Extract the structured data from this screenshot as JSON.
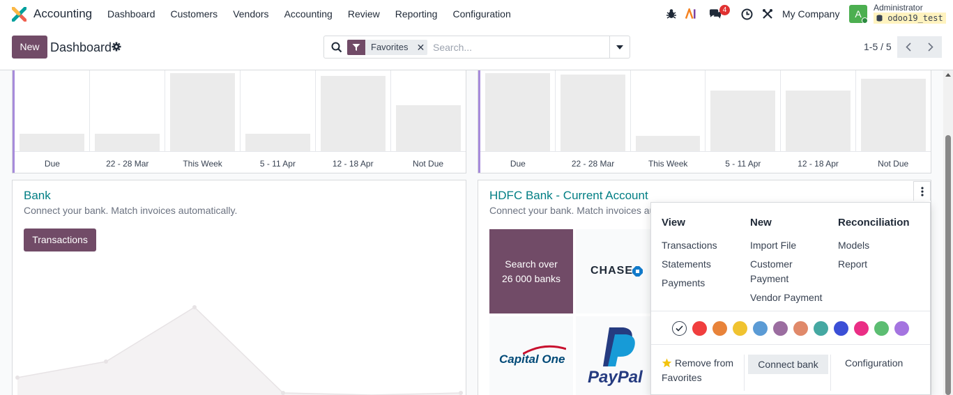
{
  "navbar": {
    "app_name": "Accounting",
    "menu": [
      "Dashboard",
      "Customers",
      "Vendors",
      "Accounting",
      "Review",
      "Reporting",
      "Configuration"
    ],
    "chat_count": "4",
    "company": "My Company",
    "user_initial": "A",
    "user_name": "Administrator",
    "database": "odoo19_test"
  },
  "control_panel": {
    "new_label": "New",
    "breadcrumb": "Dashboard",
    "facet_label": "Favorites",
    "search_placeholder": "Search...",
    "pager": "1-5 / 5"
  },
  "graphs": [
    {
      "labels": [
        "Due",
        "22 - 28 Mar",
        "This Week",
        "5 - 11 Apr",
        "12 - 18 Apr",
        "Not Due"
      ],
      "bar_levels": [
        0.22,
        0.22,
        1.0,
        0.22,
        0.96,
        0.59
      ]
    },
    {
      "labels": [
        "Due",
        "22 - 28 Mar",
        "This Week",
        "5 - 11 Apr",
        "12 - 18 Apr",
        "Not Due"
      ],
      "bar_levels": [
        1.0,
        0.98,
        0.2,
        0.78,
        0.78,
        0.93
      ]
    }
  ],
  "bank_card": {
    "title": "Bank",
    "subtitle": "Connect your bank. Match invoices automatically.",
    "transactions_label": "Transactions"
  },
  "hdfc_card": {
    "title": "HDFC Bank - Current Account",
    "subtitle": "Connect your bank. Match invoices automatically.",
    "search_banks_line1": "Search over",
    "search_banks_line2": "26 000 banks",
    "bank_logos": [
      "CHASE",
      "Capital One",
      "PayPal"
    ]
  },
  "dropdown": {
    "view_heading": "View",
    "view_items": [
      "Transactions",
      "Statements",
      "Payments"
    ],
    "new_heading": "New",
    "new_items": [
      "Import File",
      "Customer Payment",
      "Vendor Payment"
    ],
    "reconciliation_heading": "Reconciliation",
    "reconciliation_items": [
      "Models",
      "Report"
    ],
    "colors": [
      "#ffffff",
      "#f03e3e",
      "#e8833a",
      "#f0c330",
      "#5b9bd5",
      "#9b6da0",
      "#e0896a",
      "#45a8a2",
      "#3b4fd6",
      "#ea2e85",
      "#5cbd72",
      "#a474e0"
    ],
    "remove_favorites": "Remove from Favorites",
    "connect_bank": "Connect bank",
    "configuration": "Configuration"
  }
}
